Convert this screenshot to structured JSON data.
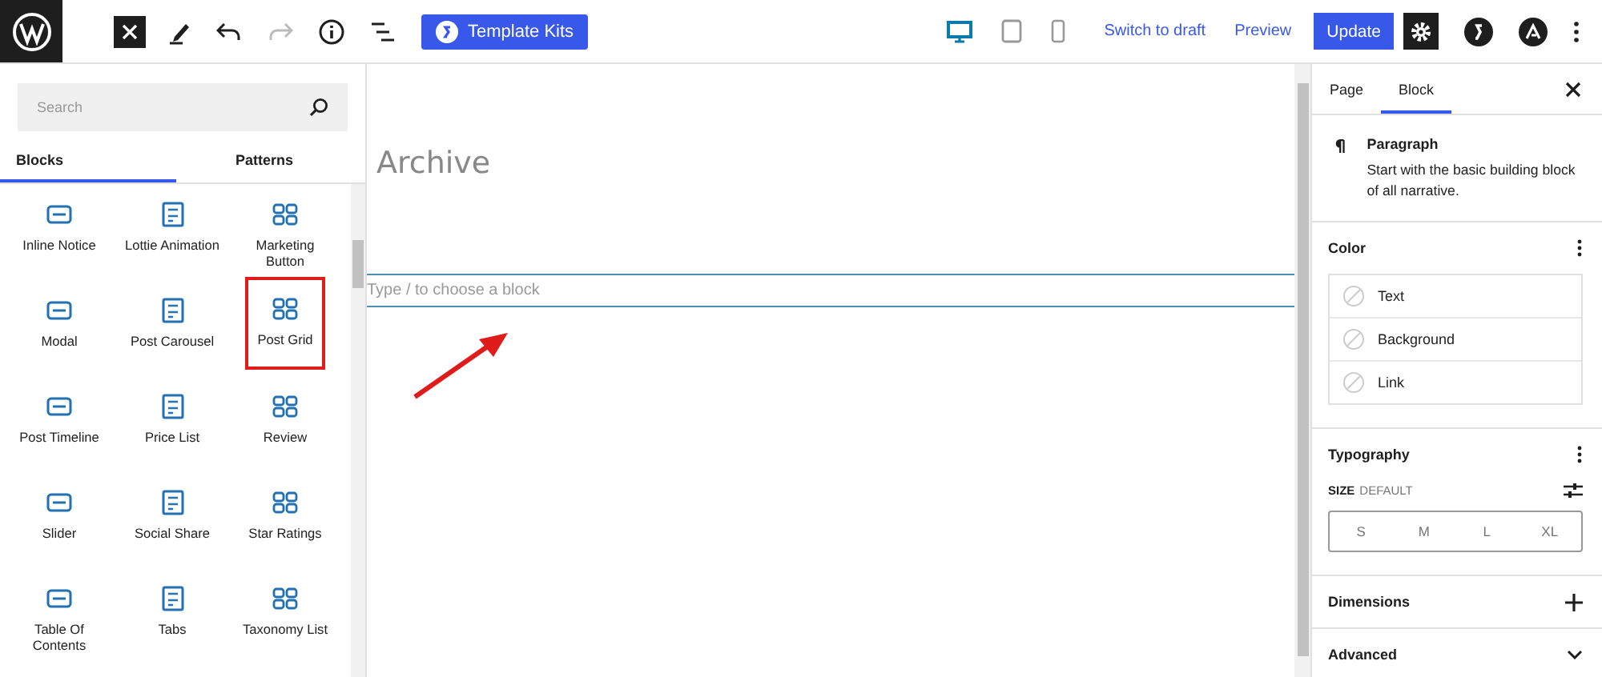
{
  "toolbar": {
    "template_kits": "Template Kits",
    "devices": [
      {
        "kind": "desktop",
        "selected": true
      },
      {
        "kind": "tablet",
        "selected": false
      },
      {
        "kind": "mobile",
        "selected": false
      }
    ],
    "switch_to_draft": "Switch to draft",
    "preview": "Preview",
    "update": "Update"
  },
  "inserter": {
    "search": {
      "placeholder": "Search"
    },
    "tabs": [
      {
        "label": "Blocks",
        "selected": true
      },
      {
        "label": "Patterns",
        "selected": false
      }
    ],
    "blocks": [
      {
        "label": "Inline Notice",
        "highlighted": false
      },
      {
        "label": "Lottie Animation",
        "highlighted": false
      },
      {
        "label": "Marketing Button",
        "highlighted": false
      },
      {
        "label": "Modal",
        "highlighted": false
      },
      {
        "label": "Post Carousel",
        "highlighted": false
      },
      {
        "label": "Post Grid",
        "highlighted": true
      },
      {
        "label": "Post Timeline",
        "highlighted": false
      },
      {
        "label": "Price List",
        "highlighted": false
      },
      {
        "label": "Review",
        "highlighted": false
      },
      {
        "label": "Slider",
        "highlighted": false
      },
      {
        "label": "Social Share",
        "highlighted": false
      },
      {
        "label": "Star Ratings",
        "highlighted": false
      },
      {
        "label": "Table Of Contents",
        "highlighted": false
      },
      {
        "label": "Tabs",
        "highlighted": false
      },
      {
        "label": "Taxonomy List",
        "highlighted": false
      }
    ]
  },
  "canvas": {
    "title": "Archive",
    "block_placeholder": "Type / to choose a block"
  },
  "settings": {
    "tabs": [
      {
        "label": "Page",
        "selected": false
      },
      {
        "label": "Block",
        "selected": true
      }
    ],
    "block": {
      "name": "Paragraph",
      "description": "Start with the basic building block of all narrative."
    },
    "color": {
      "title": "Color",
      "items": [
        "Text",
        "Background",
        "Link"
      ]
    },
    "typography": {
      "title": "Typography",
      "size_label": "SIZE",
      "size_value": "DEFAULT",
      "sizes": [
        {
          "label": "S",
          "selected": false
        },
        {
          "label": "M",
          "selected": false
        },
        {
          "label": "L",
          "selected": false
        },
        {
          "label": "XL",
          "selected": false
        }
      ]
    },
    "panels": [
      {
        "title": "Dimensions",
        "expanded": false,
        "kind": "plus"
      },
      {
        "title": "Advanced",
        "expanded": false,
        "kind": "chevron"
      }
    ]
  }
}
